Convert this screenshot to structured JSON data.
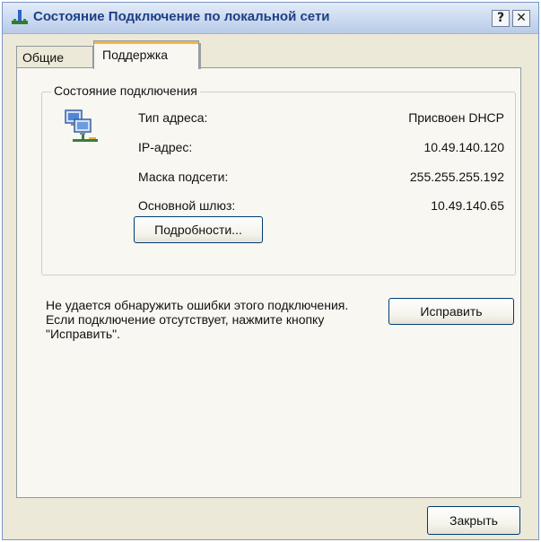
{
  "window": {
    "title": "Состояние Подключение по локальной сети",
    "help_label": "?",
    "close_label": "✕"
  },
  "tabs": [
    {
      "label": "Общие",
      "selected": false
    },
    {
      "label": "Поддержка",
      "selected": true
    }
  ],
  "connection_status": {
    "group_title": "Состояние подключения",
    "rows": [
      {
        "label": "Тип адреса:",
        "value": "Присвоен DHCP"
      },
      {
        "label": "IP-адрес:",
        "value": "10.49.140.120"
      },
      {
        "label": "Маска подсети:",
        "value": "255.255.255.192"
      },
      {
        "label": "Основной шлюз:",
        "value": "10.49.140.65"
      }
    ],
    "details_button": "Подробности..."
  },
  "repair": {
    "message": "Не удается обнаружить ошибки этого подключения. Если подключение отсутствует, нажмите кнопку \"Исправить\".",
    "button": "Исправить"
  },
  "footer": {
    "close_button": "Закрыть"
  },
  "icons": {
    "title_icon": "network-connection-icon",
    "status_icon": "network-computers-icon"
  }
}
